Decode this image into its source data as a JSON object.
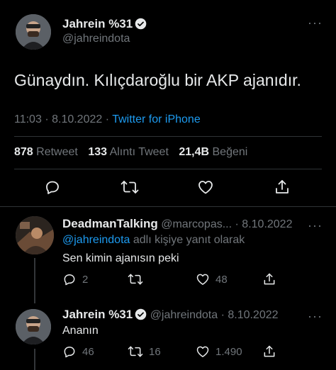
{
  "main_tweet": {
    "author_name": "Jahrein %31",
    "author_handle": "@jahreindota",
    "text": "Günaydın. Kılıçdaroğlu bir AKP ajanıdır.",
    "time": "11:03",
    "sep1": "·",
    "date": "8.10.2022",
    "sep2": "·",
    "source": "Twitter for iPhone",
    "retweets": "878",
    "retweets_label": "Retweet",
    "quotes": "133",
    "quotes_label": "Alıntı Tweet",
    "likes": "21,4B",
    "likes_label": "Beğeni",
    "more": "···"
  },
  "reply1": {
    "author_name": "DeadmanTalking",
    "author_handle": "@marcopas...",
    "sep": "·",
    "date": "8.10.2022",
    "reply_to_handle": "@jahreindota",
    "reply_to_suffix": " adlı kişiye yanıt olarak",
    "text": "Sen kimin ajanısın peki",
    "reply_count": "2",
    "retweet_count": "",
    "like_count": "48",
    "more": "···"
  },
  "reply2": {
    "author_name": "Jahrein %31",
    "author_handle": "@jahreindota",
    "sep": "·",
    "date": "8.10.2022",
    "text": "Ananın",
    "reply_count": "46",
    "retweet_count": "16",
    "like_count": "1.490",
    "more": "···"
  },
  "colors": {
    "background": "#000000",
    "text": "#e7e9ea",
    "muted": "#71767b",
    "accent": "#1d9bf0",
    "divider": "#2f3336"
  },
  "icons": [
    "verified-badge-icon",
    "reply-icon",
    "retweet-icon",
    "like-icon",
    "share-icon",
    "more-icon"
  ]
}
